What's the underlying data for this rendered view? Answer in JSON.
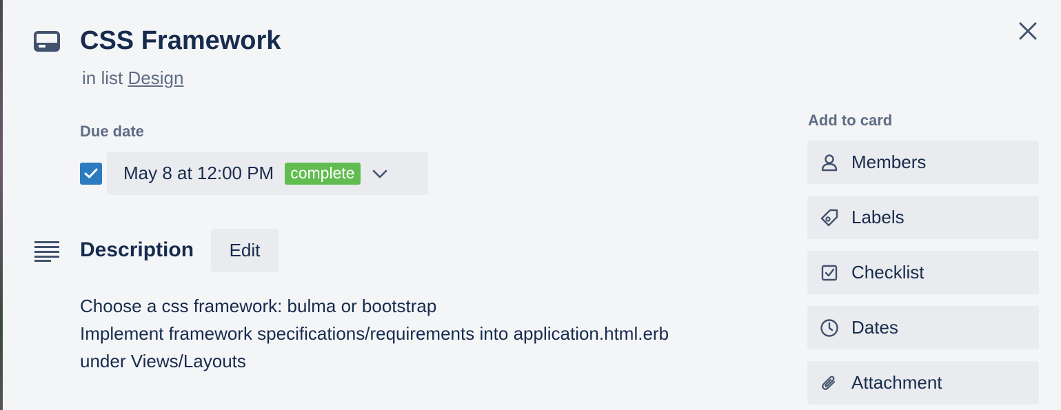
{
  "card": {
    "title": "CSS Framework",
    "list_prefix": "in list",
    "list_name": "Design"
  },
  "due_date": {
    "heading": "Due date",
    "checked": true,
    "date_text": "May 8 at 12:00 PM",
    "status_badge": "complete"
  },
  "description": {
    "heading": "Description",
    "edit_label": "Edit",
    "lines": [
      "Choose a css framework: bulma or bootstrap",
      "Implement framework specifications/requirements into application.html.erb",
      "under Views/Layouts"
    ]
  },
  "sidebar": {
    "heading": "Add to card",
    "items": [
      {
        "label": "Members",
        "icon": "person-icon"
      },
      {
        "label": "Labels",
        "icon": "tag-icon"
      },
      {
        "label": "Checklist",
        "icon": "checkbox-icon"
      },
      {
        "label": "Dates",
        "icon": "clock-icon"
      },
      {
        "label": "Attachment",
        "icon": "paperclip-icon"
      }
    ]
  },
  "colors": {
    "background": "#f4f5f7",
    "button_bg": "#e9ebee",
    "checkbox_blue": "#2c7bbf",
    "complete_green": "#61bd4f",
    "text_primary": "#172b4d",
    "text_muted": "#5e6c84"
  }
}
